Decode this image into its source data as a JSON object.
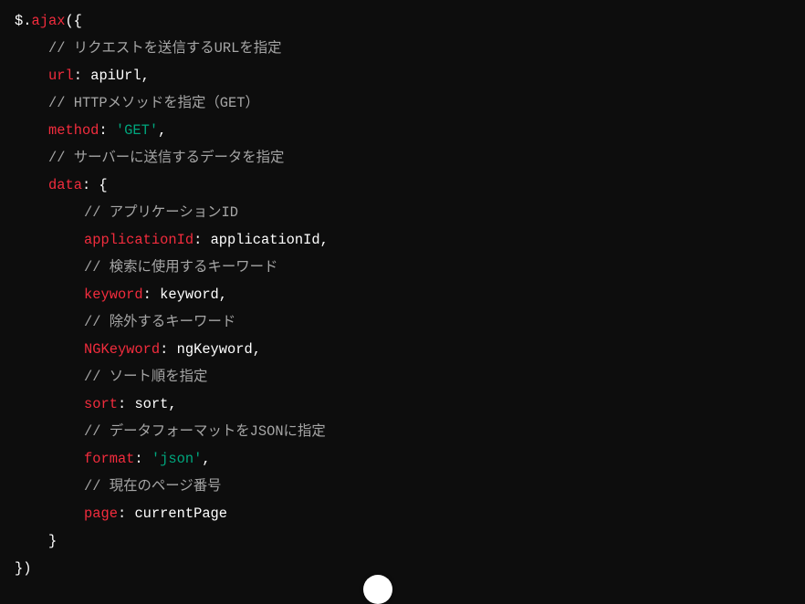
{
  "colors": {
    "background": "#0d0d0d",
    "keyword": "#f22c3d",
    "string": "#00a67d",
    "comment": "#a6a6a6",
    "plain": "#ffffff"
  },
  "code": {
    "line1": {
      "dollar": "$.",
      "fn": "ajax",
      "open": "({"
    },
    "line2": "// リクエストを送信するURLを指定",
    "line3": {
      "key": "url",
      "sep": ": ",
      "value": "apiUrl,"
    },
    "line4": "// HTTPメソッドを指定（GET）",
    "line5": {
      "key": "method",
      "sep": ": ",
      "value": "'GET'",
      "tail": ","
    },
    "line6": "// サーバーに送信するデータを指定",
    "line7": {
      "key": "data",
      "rest": ": {"
    },
    "line8": "// アプリケーションID",
    "line9": {
      "key": "applicationId",
      "sep": ": ",
      "value": "applicationId,"
    },
    "line10": "// 検索に使用するキーワード",
    "line11": {
      "key": "keyword",
      "sep": ": ",
      "value": "keyword,"
    },
    "line12": "// 除外するキーワード",
    "line13": {
      "key": "NGKeyword",
      "sep": ": ",
      "value": "ngKeyword,"
    },
    "line14": "// ソート順を指定",
    "line15": {
      "key": "sort",
      "sep": ": ",
      "value": "sort,"
    },
    "line16": "// データフォーマットをJSONに指定",
    "line17": {
      "key": "format",
      "sep": ": ",
      "value": "'json'",
      "tail": ","
    },
    "line18": "// 現在のページ番号",
    "line19": {
      "key": "page",
      "sep": ": ",
      "value": "currentPage"
    },
    "line20": "}",
    "line21": "})"
  },
  "scroll_button": {
    "icon": "scroll-down-icon"
  }
}
